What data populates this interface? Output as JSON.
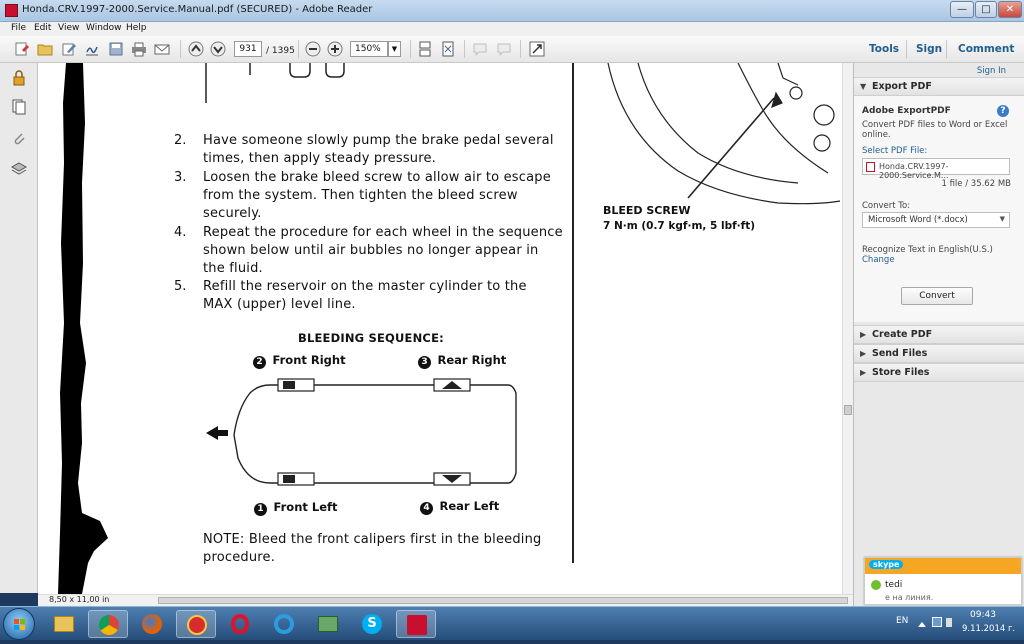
{
  "window": {
    "title": "Honda.CRV.1997-2000.Service.Manual.pdf (SECURED) - Adobe Reader",
    "minimize": "—",
    "maximize": "□",
    "close": "✕"
  },
  "menu": [
    "File",
    "Edit",
    "View",
    "Window",
    "Help"
  ],
  "toolbar": {
    "page_current": "931",
    "page_total": "/ 1395",
    "zoom": "150%",
    "links": {
      "tools": "Tools",
      "sign": "Sign",
      "comment": "Comment"
    }
  },
  "document": {
    "steps": [
      {
        "num": "2.",
        "lines": [
          "Have someone slowly pump the brake pedal several",
          "times, then apply steady pressure."
        ]
      },
      {
        "num": "3.",
        "lines": [
          "Loosen the brake bleed screw to allow air to escape",
          "from the system. Then tighten the bleed screw",
          "securely."
        ]
      },
      {
        "num": "4.",
        "lines": [
          "Repeat the procedure for each wheel in the sequence",
          "shown below until air bubbles no longer appear in",
          "the fluid."
        ]
      },
      {
        "num": "5.",
        "lines": [
          "Refill the reservoir on the master cylinder to the",
          "MAX (upper) level line."
        ]
      }
    ],
    "sequence_title": "BLEEDING SEQUENCE:",
    "wheels": {
      "front_right": {
        "num": "2",
        "label": "Front Right"
      },
      "rear_right": {
        "num": "3",
        "label": "Rear Right"
      },
      "front_left": {
        "num": "1",
        "label": "Front Left"
      },
      "rear_left": {
        "num": "4",
        "label": "Rear Left"
      }
    },
    "note_lines": [
      "NOTE:  Bleed the front calipers first in the bleeding",
      "procedure."
    ],
    "bleed_screw_label": "BLEED SCREW",
    "bleed_screw_torque": "7 N·m (0.7 kgf·m, 5 lbf·ft)",
    "page_size": "8,50 x 11,00 in"
  },
  "rightpane": {
    "sign_in": "Sign In",
    "export_header": "Export PDF",
    "service_title": "Adobe ExportPDF",
    "service_desc": [
      "Convert PDF files to Word or Excel",
      "online."
    ],
    "select_label": "Select PDF File:",
    "file_name": "Honda.CRV.1997-2000.Service.M...",
    "file_count": "1 file / 35.62 MB",
    "convert_to_label": "Convert To:",
    "convert_to_value": "Microsoft Word (*.docx)",
    "recognize_text": "Recognize Text in English(U.S.)",
    "change_link": "Change",
    "convert_button": "Convert",
    "sections": [
      "Create PDF",
      "Send Files",
      "Store Files"
    ]
  },
  "skype": {
    "brand": "skype",
    "contact": "tedi",
    "status": "е на линия."
  },
  "taskbar": {
    "language": "EN",
    "time": "09:43",
    "date": "9.11.2014 г."
  },
  "colors": {
    "title_bar": "#b7cfe8",
    "link_blue": "#1f5e8f",
    "taskbar": "#2f5e91",
    "skype_orange": "#f5a623"
  }
}
